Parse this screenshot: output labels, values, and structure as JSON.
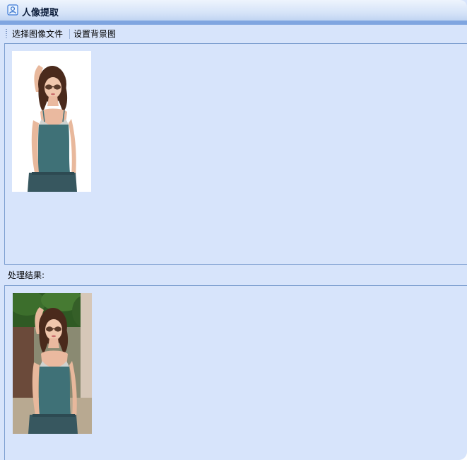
{
  "window": {
    "title": "人像提取",
    "icon": "portrait-app-icon"
  },
  "toolbar": {
    "select_image_label": "选择图像文件",
    "set_background_label": "设置背景图"
  },
  "result": {
    "label": "处理结果:"
  },
  "colors": {
    "window_bg": "#d7e4fb",
    "titlebar_band": "#7fa5e0",
    "panel_border": "#7d9fd0"
  }
}
